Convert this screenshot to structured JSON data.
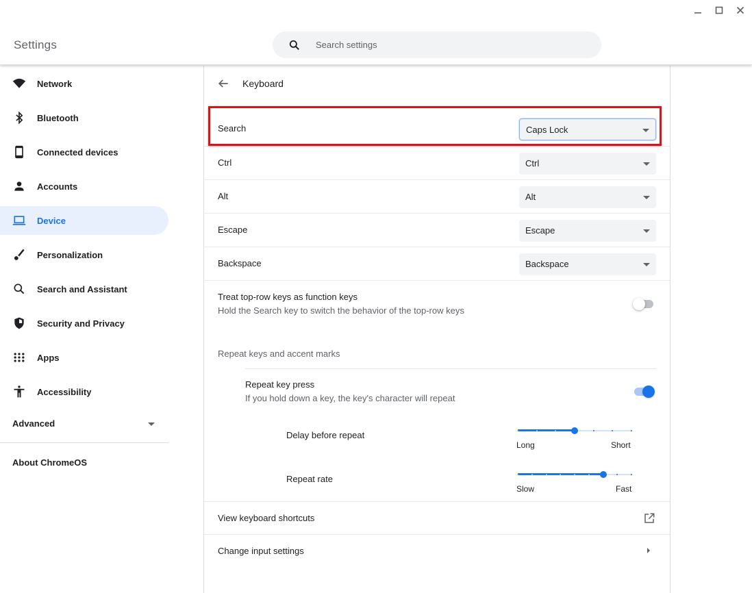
{
  "window": {
    "controls": [
      "minimize",
      "maximize",
      "close"
    ]
  },
  "header": {
    "title": "Settings",
    "search_placeholder": "Search settings",
    "search_value": ""
  },
  "sidebar": {
    "items": [
      {
        "label": "Network",
        "icon": "wifi-icon",
        "selected": false
      },
      {
        "label": "Bluetooth",
        "icon": "bluetooth-icon",
        "selected": false
      },
      {
        "label": "Connected devices",
        "icon": "phone-icon",
        "selected": false
      },
      {
        "label": "Accounts",
        "icon": "person-icon",
        "selected": false
      },
      {
        "label": "Device",
        "icon": "laptop-icon",
        "selected": true
      },
      {
        "label": "Personalization",
        "icon": "brush-icon",
        "selected": false
      },
      {
        "label": "Search and Assistant",
        "icon": "search-icon",
        "selected": false
      },
      {
        "label": "Security and Privacy",
        "icon": "shield-icon",
        "selected": false
      },
      {
        "label": "Apps",
        "icon": "apps-grid-icon",
        "selected": false
      },
      {
        "label": "Accessibility",
        "icon": "accessibility-icon",
        "selected": false
      }
    ],
    "advanced_label": "Advanced",
    "about_label": "About ChromeOS"
  },
  "main": {
    "title": "Keyboard",
    "key_mappings": [
      {
        "label": "Search",
        "value": "Caps Lock",
        "highlighted": true
      },
      {
        "label": "Ctrl",
        "value": "Ctrl"
      },
      {
        "label": "Alt",
        "value": "Alt"
      },
      {
        "label": "Escape",
        "value": "Escape"
      },
      {
        "label": "Backspace",
        "value": "Backspace"
      }
    ],
    "top_row": {
      "title": "Treat top-row keys as function keys",
      "description": "Hold the Search key to switch the behavior of the top-row keys",
      "enabled": false
    },
    "repeat_section": {
      "header": "Repeat keys and accent marks",
      "repeat_key_press": {
        "title": "Repeat key press",
        "description": "If you hold down a key, the key's character will repeat",
        "enabled": true
      },
      "delay": {
        "label": "Delay before repeat",
        "min_label": "Long",
        "max_label": "Short",
        "steps": 7,
        "value_index": 3
      },
      "rate": {
        "label": "Repeat rate",
        "min_label": "Slow",
        "max_label": "Fast",
        "steps": 9,
        "value_index": 6
      }
    },
    "links": [
      {
        "label": "View keyboard shortcuts",
        "icon": "open-in-new-icon"
      },
      {
        "label": "Change input settings",
        "icon": "chevron-right-icon"
      }
    ]
  },
  "colors": {
    "accent": "#1a73e8",
    "selected_bg": "#e8f0fe",
    "annotation_red": "#d8141a"
  }
}
